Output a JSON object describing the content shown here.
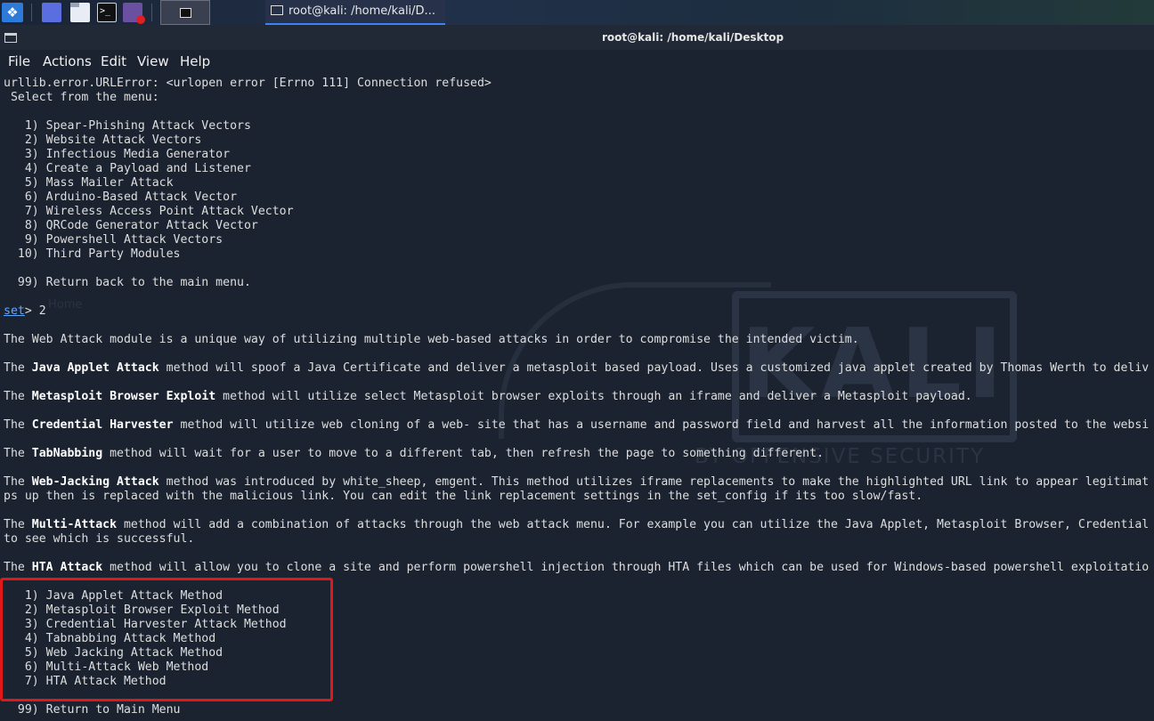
{
  "taskbar": {
    "task_window_title": "root@kali: /home/kali/D..."
  },
  "window": {
    "title": "root@kali: /home/kali/Desktop"
  },
  "menu": {
    "file": "File",
    "actions": "Actions",
    "edit": "Edit",
    "view": "View",
    "help": "Help"
  },
  "terminal": {
    "error_line": "urllib.error.URLError: <urlopen error [Errno 111] Connection refused>",
    "select_line": " Select from the menu:",
    "main_menu": [
      "   1) Spear-Phishing Attack Vectors",
      "   2) Website Attack Vectors",
      "   3) Infectious Media Generator",
      "   4) Create a Payload and Listener",
      "   5) Mass Mailer Attack",
      "   6) Arduino-Based Attack Vector",
      "   7) Wireless Access Point Attack Vector",
      "   8) QRCode Generator Attack Vector",
      "   9) Powershell Attack Vectors",
      "  10) Third Party Modules"
    ],
    "return_main": "  99) Return back to the main menu.",
    "prompt_word": "set",
    "prompt_rest": "> 2",
    "intro": "The Web Attack module is a unique way of utilizing multiple web-based attacks in order to compromise the intended victim.",
    "java_pre": "The ",
    "java_bold": "Java Applet Attack",
    "java_rest": " method will spoof a Java Certificate and deliver a metasploit based payload. Uses a customized java applet created by Thomas Werth to deliv",
    "msf_pre": "The ",
    "msf_bold": "Metasploit Browser Exploit",
    "msf_rest": " method will utilize select Metasploit browser exploits through an iframe and deliver a Metasploit payload.",
    "cred_pre": "The ",
    "cred_bold": "Credential Harvester",
    "cred_rest": " method will utilize web cloning of a web- site that has a username and password field and harvest all the information posted to the websi",
    "tab_pre": "The ",
    "tab_bold": "TabNabbing",
    "tab_rest": " method will wait for a user to move to a different tab, then refresh the page to something different.",
    "wj_pre": "The ",
    "wj_bold": "Web-Jacking Attack",
    "wj_rest": " method was introduced by white_sheep, emgent. This method utilizes iframe replacements to make the highlighted URL link to appear legitimat",
    "wj_line2": "ps up then is replaced with the malicious link. You can edit the link replacement settings in the set_config if its too slow/fast.",
    "multi_pre": "The ",
    "multi_bold": "Multi-Attack",
    "multi_rest": " method will add a combination of attacks through the web attack menu. For example you can utilize the Java Applet, Metasploit Browser, Credential",
    "multi_line2": "to see which is successful.",
    "hta_pre": "The ",
    "hta_bold": "HTA Attack",
    "hta_rest": " method will allow you to clone a site and perform powershell injection through HTA files which can be used for Windows-based powershell exploitatio",
    "web_menu": [
      "   1) Java Applet Attack Method",
      "   2) Metasploit Browser Exploit Method",
      "   3) Credential Harvester Attack Method",
      "   4) Tabnabbing Attack Method",
      "   5) Web Jacking Attack Method",
      "   6) Multi-Attack Web Method",
      "   7) HTA Attack Method"
    ],
    "return_web": "  99) Return to Main Menu"
  },
  "watermark": {
    "logo_text": "KALI",
    "tagline": "BY OFFENSIVE SECURITY",
    "home_label": "Home"
  },
  "colors": {
    "terminal_bg": "#1b2230",
    "text": "#dedede",
    "highlight_border": "#e01818",
    "prompt": "#5fa8ff"
  }
}
